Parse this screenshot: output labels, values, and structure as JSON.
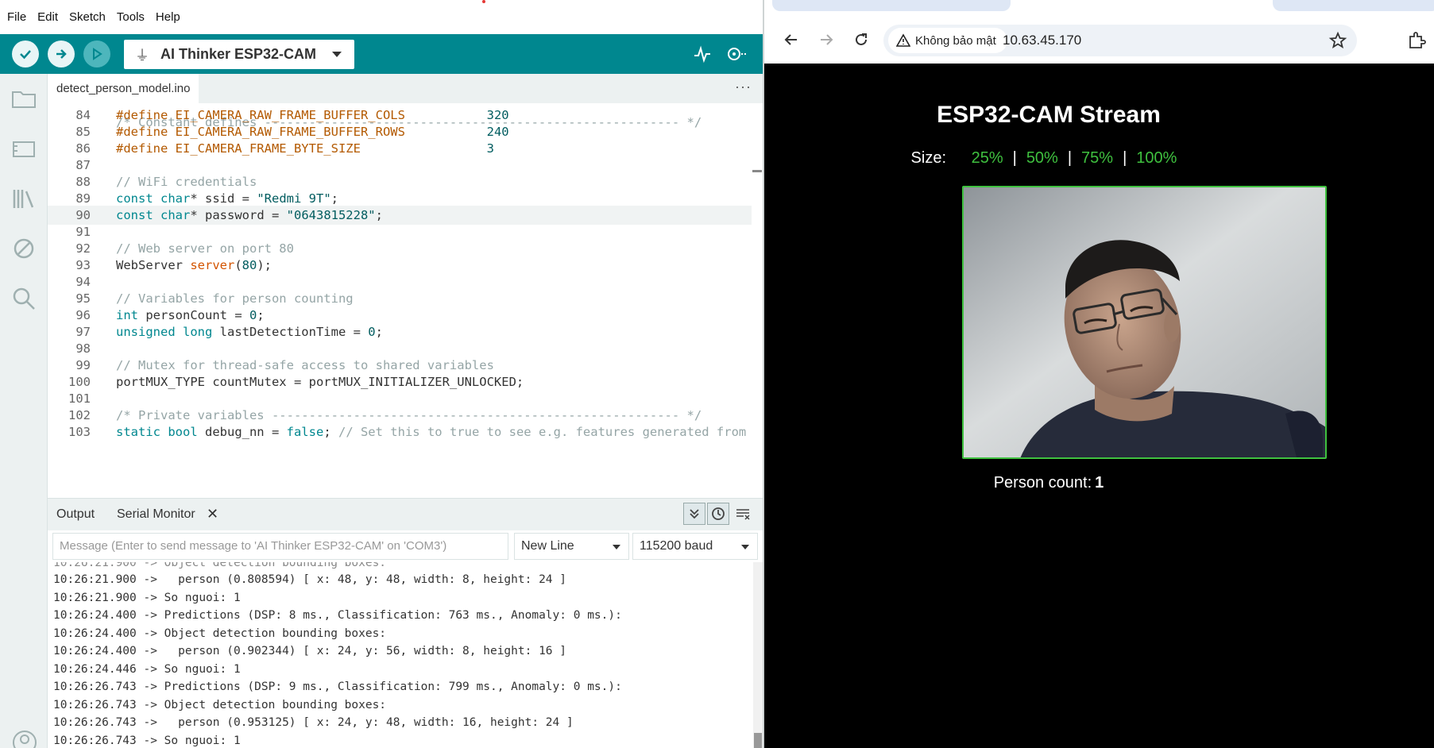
{
  "ide": {
    "menu": [
      "File",
      "Edit",
      "Sketch",
      "Tools",
      "Help"
    ],
    "board": "AI Thinker ESP32-CAM",
    "file_tab": "detect_person_model.ino",
    "more": "···",
    "code_lines": [
      {
        "n": "84",
        "parts": [
          [
            "mac",
            "#define EI_CAMERA_RAW_FRAME_BUFFER_COLS"
          ],
          [
            "",
            "           "
          ],
          [
            "str",
            "320"
          ]
        ]
      },
      {
        "n": "85",
        "parts": [
          [
            "mac",
            "#define EI_CAMERA_RAW_FRAME_BUFFER_ROWS"
          ],
          [
            "",
            "           "
          ],
          [
            "str",
            "240"
          ]
        ]
      },
      {
        "n": "86",
        "parts": [
          [
            "mac",
            "#define EI_CAMERA_FRAME_BYTE_SIZE"
          ],
          [
            "",
            "                 "
          ],
          [
            "str",
            "3"
          ]
        ]
      },
      {
        "n": "87",
        "parts": []
      },
      {
        "n": "88",
        "parts": [
          [
            "cm",
            "// WiFi credentials"
          ]
        ]
      },
      {
        "n": "89",
        "parts": [
          [
            "kw",
            "const char"
          ],
          [
            "",
            "* ssid = "
          ],
          [
            "str",
            "\"Redmi 9T\""
          ],
          [
            "",
            ";"
          ]
        ]
      },
      {
        "n": "90",
        "parts": [
          [
            "kw",
            "const char"
          ],
          [
            "",
            "* password = "
          ],
          [
            "str",
            "\"0643815228\""
          ],
          [
            "",
            ";"
          ]
        ],
        "current": true
      },
      {
        "n": "91",
        "parts": []
      },
      {
        "n": "92",
        "parts": [
          [
            "cm",
            "// Web server on port 80"
          ]
        ]
      },
      {
        "n": "93",
        "parts": [
          [
            "",
            "WebServer "
          ],
          [
            "fn",
            "server"
          ],
          [
            "",
            "("
          ],
          [
            "str",
            "80"
          ],
          [
            "",
            ");"
          ]
        ]
      },
      {
        "n": "94",
        "parts": []
      },
      {
        "n": "95",
        "parts": [
          [
            "cm",
            "// Variables for person counting"
          ]
        ]
      },
      {
        "n": "96",
        "parts": [
          [
            "kw",
            "int"
          ],
          [
            "",
            " personCount = "
          ],
          [
            "str",
            "0"
          ],
          [
            "",
            ";"
          ]
        ]
      },
      {
        "n": "97",
        "parts": [
          [
            "kw",
            "unsigned long"
          ],
          [
            "",
            " lastDetectionTime = "
          ],
          [
            "str",
            "0"
          ],
          [
            "",
            ";"
          ]
        ]
      },
      {
        "n": "98",
        "parts": []
      },
      {
        "n": "99",
        "parts": [
          [
            "cm",
            "// Mutex for thread-safe access to shared variables"
          ]
        ]
      },
      {
        "n": "100",
        "parts": [
          [
            "",
            "portMUX_TYPE countMutex = portMUX_INITIALIZER_UNLOCKED;"
          ]
        ]
      },
      {
        "n": "101",
        "parts": []
      },
      {
        "n": "102",
        "parts": [
          [
            "cm",
            "/* Private variables ------------------------------------------------------- */"
          ]
        ]
      },
      {
        "n": "103",
        "parts": [
          [
            "kw",
            "static bool"
          ],
          [
            "",
            " debug_nn = "
          ],
          [
            "kw",
            "false"
          ],
          [
            "",
            "; "
          ],
          [
            "cm",
            "// Set this to true to see e.g. features generated from"
          ]
        ]
      }
    ],
    "panel": {
      "tab_output": "Output",
      "tab_serial": "Serial Monitor",
      "close": "✕",
      "message_placeholder": "Message (Enter to send message to 'AI Thinker ESP32-CAM' on 'COM3')",
      "line_ending": "New Line",
      "baud": "115200 baud"
    },
    "serial_log": [
      "10:26:21.900 ->   person (0.808594) [ x: 48, y: 48, width: 8, height: 24 ]",
      "10:26:21.900 -> So nguoi: 1",
      "10:26:24.400 -> Predictions (DSP: 8 ms., Classification: 763 ms., Anomaly: 0 ms.):",
      "10:26:24.400 -> Object detection bounding boxes:",
      "10:26:24.400 ->   person (0.902344) [ x: 24, y: 56, width: 8, height: 16 ]",
      "10:26:24.446 -> So nguoi: 1",
      "10:26:26.743 -> Predictions (DSP: 9 ms., Classification: 799 ms., Anomaly: 0 ms.):",
      "10:26:26.743 -> Object detection bounding boxes:",
      "10:26:26.743 ->   person (0.953125) [ x: 24, y: 48, width: 16, height: 24 ]",
      "10:26:26.743 -> So nguoi: 1"
    ]
  },
  "browser": {
    "security_label": "Không bảo mật",
    "url": "10.63.45.170",
    "page_title": "ESP32-CAM Stream",
    "size_label": "Size:",
    "sizes": [
      "25%",
      "50%",
      "75%",
      "100%"
    ],
    "separator": "|",
    "person_count_label": "Person count:",
    "person_count_value": "1"
  },
  "colors": {
    "toolbar": "#00878f",
    "accent_green": "#3fc13f"
  }
}
